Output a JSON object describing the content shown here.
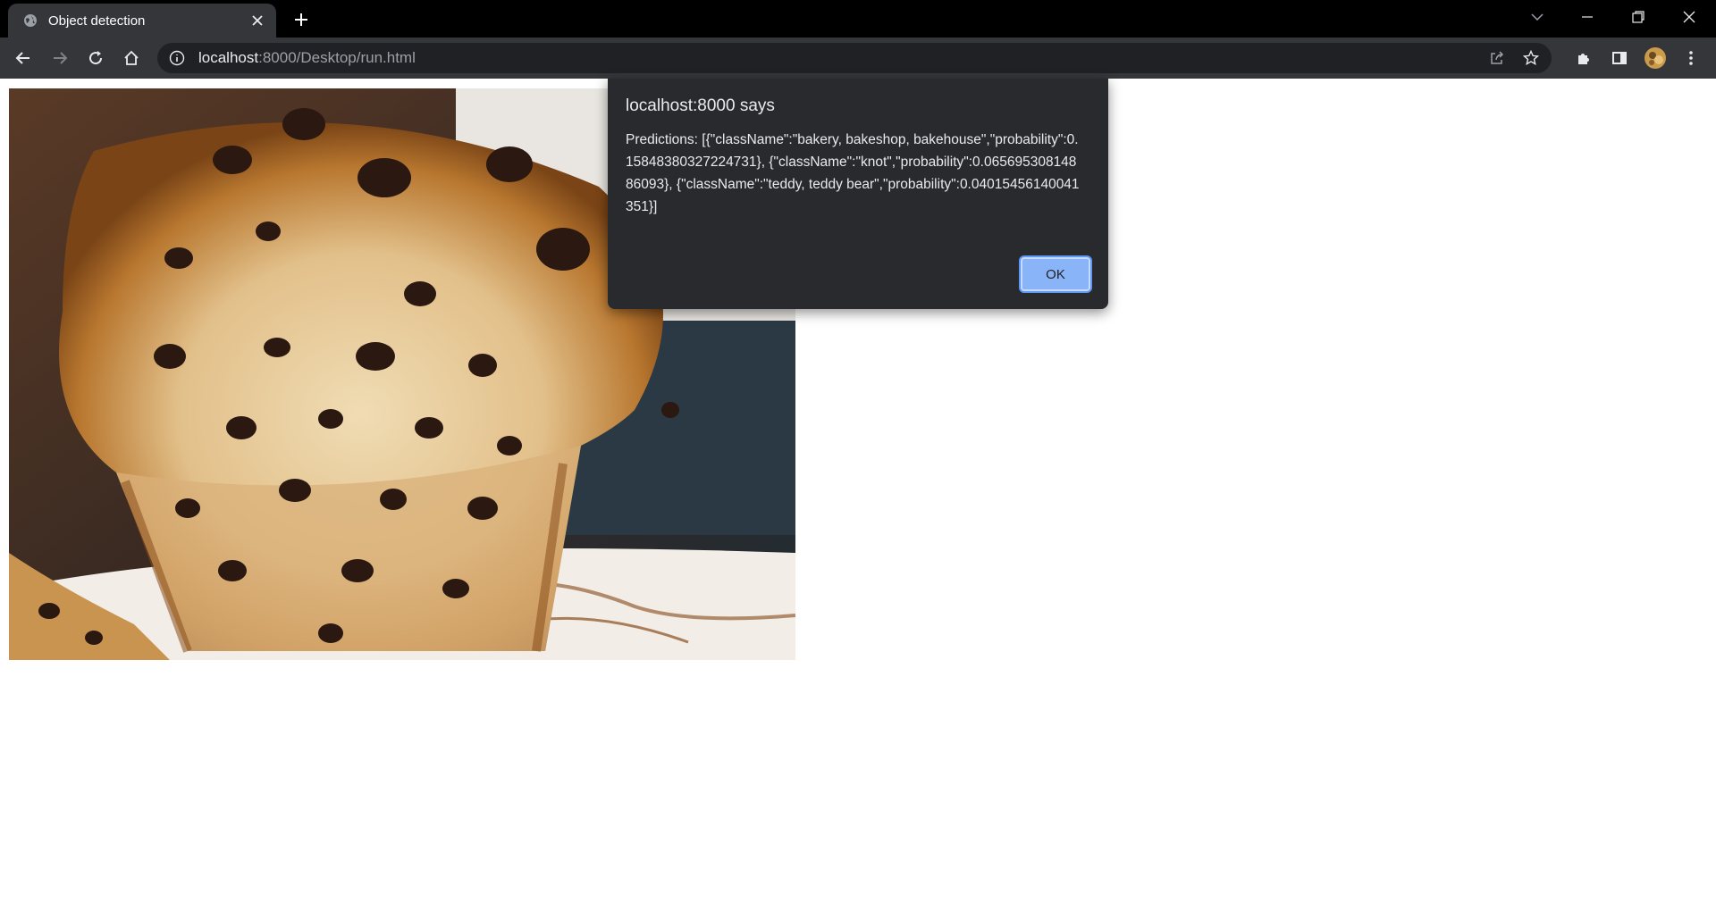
{
  "browser": {
    "tab": {
      "title": "Object detection",
      "favicon": "globe-icon"
    },
    "address": {
      "host": "localhost",
      "rest": ":8000/Desktop/run.html"
    },
    "colors": {
      "frame": "#000000",
      "toolbar": "#35363a",
      "omnibox": "#202124"
    }
  },
  "dialog": {
    "title": "localhost:8000 says",
    "message": "Predictions: [{\"className\":\"bakery, bakeshop, bakehouse\",\"probability\":0.15848380327224731}, {\"className\":\"knot\",\"probability\":0.06569530814886093}, {\"className\":\"teddy, teddy bear\",\"probability\":0.04015456140041351}]",
    "ok_label": "OK",
    "accent": "#8ab4f8"
  },
  "page": {
    "image": {
      "subject": "chocolate-chip-muffin"
    }
  }
}
